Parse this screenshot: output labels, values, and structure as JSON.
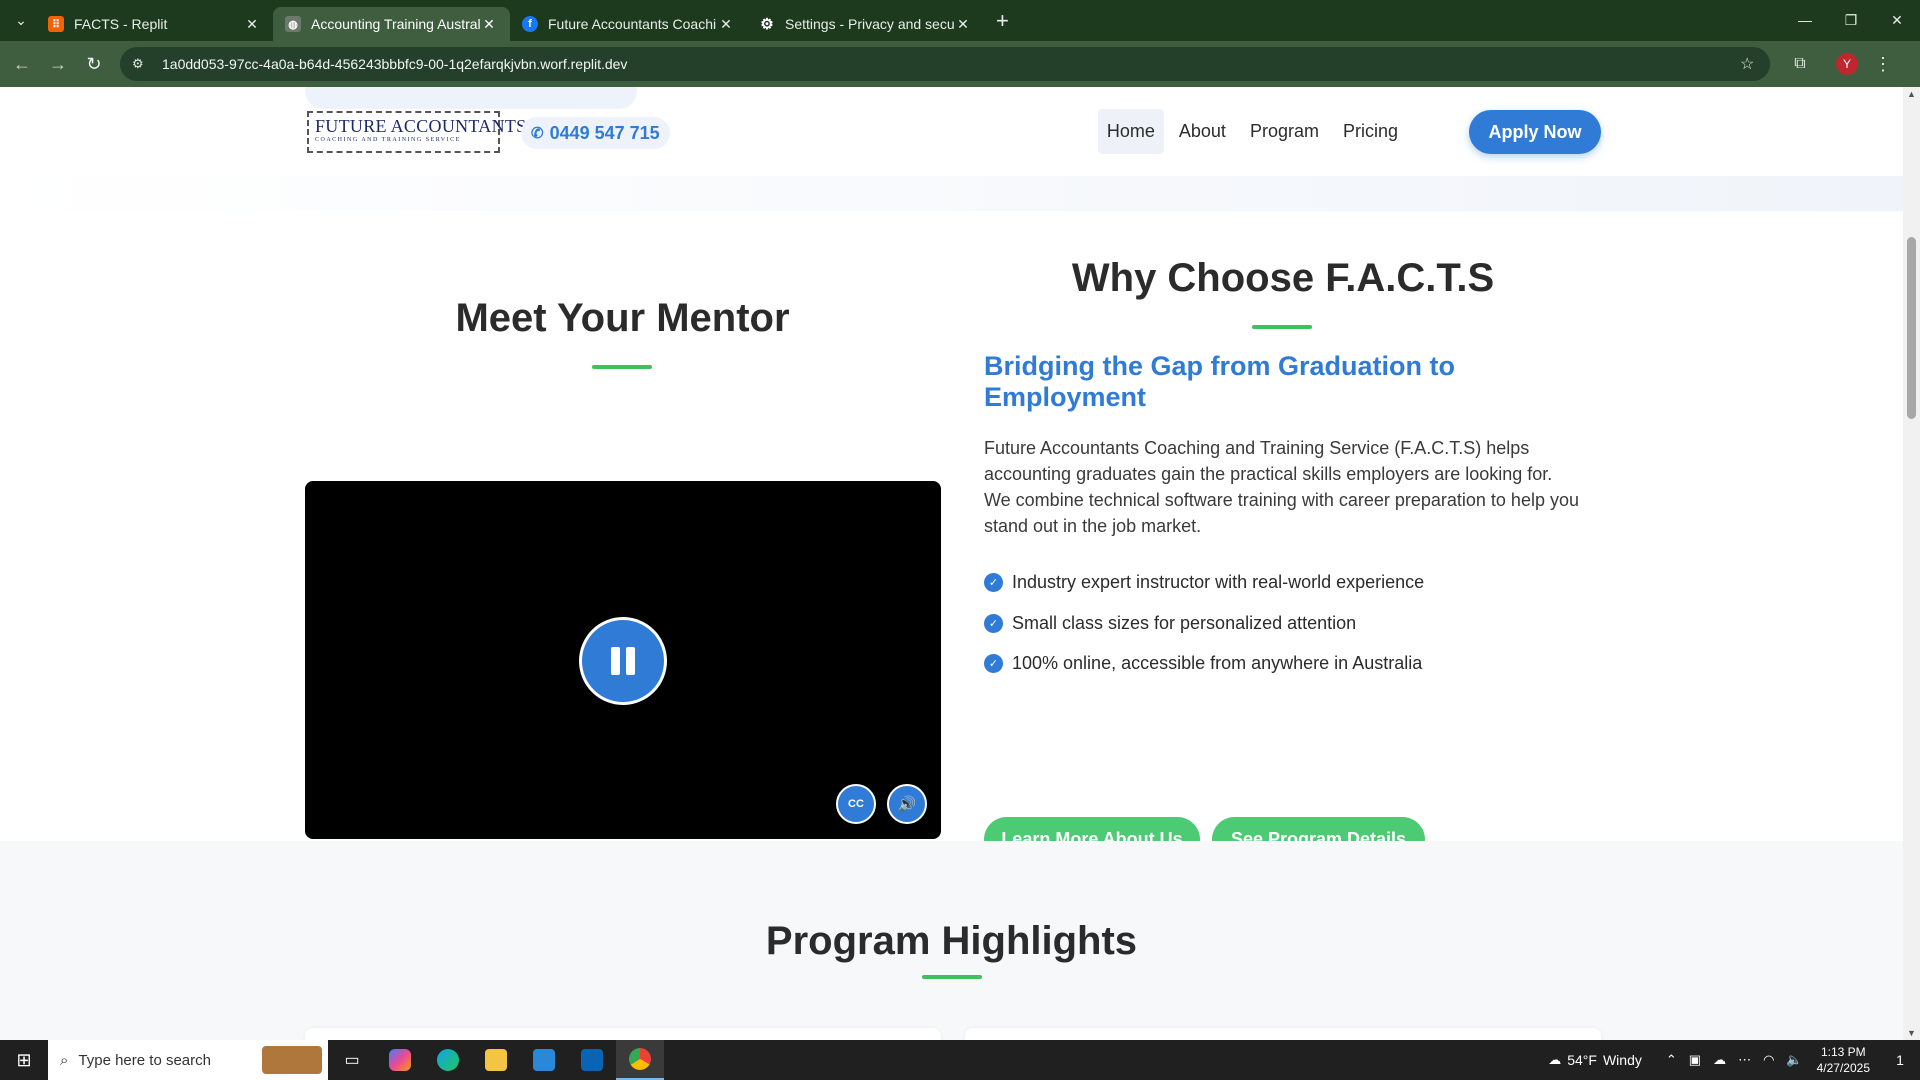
{
  "browser": {
    "tabs": [
      {
        "title": "FACTS - Replit",
        "active": false,
        "favicon": "replit-icon"
      },
      {
        "title": "Accounting Training Australia | ",
        "active": true,
        "favicon": "globe-icon"
      },
      {
        "title": "Future Accountants Coaching & ",
        "active": false,
        "favicon": "facebook-icon"
      },
      {
        "title": "Settings - Privacy and security",
        "active": false,
        "favicon": "gear-icon"
      }
    ],
    "url": "1a0dd053-97cc-4a0a-b64d-456243bbbfc9-00-1q2efarqkjvbn.worf.replit.dev",
    "profile_initial": "Y"
  },
  "header": {
    "logo_line1": "FUTURE ACCOUNTANTS",
    "logo_line2": "COACHING AND TRAINING SERVICE",
    "phone": "0449 547 715",
    "nav": [
      "Home",
      "About",
      "Program",
      "Pricing"
    ],
    "nav_active": "Home",
    "apply_label": "Apply Now"
  },
  "mentor": {
    "title": "Meet Your Mentor",
    "cc_label": "CC"
  },
  "why": {
    "title": "Why Choose F.A.C.T.S",
    "subheading": "Bridging the Gap from Graduation to Employment",
    "paragraph": "Future Accountants Coaching and Training Service (F.A.C.T.S) helps accounting graduates gain the practical skills employers are looking for. We combine technical software training with career preparation to help you stand out in the job market.",
    "features": [
      "Industry expert instructor with real-world experience",
      "Small class sizes for personalized attention",
      "100% online, accessible from anywhere in Australia"
    ],
    "btn_learn": "Learn More About Us",
    "btn_program": "See Program Details"
  },
  "highlights": {
    "title": "Program Highlights"
  },
  "taskbar": {
    "search_placeholder": "Type here to search",
    "weather_temp": "54°F",
    "weather_desc": "Windy",
    "time": "1:13 PM",
    "date": "4/27/2025",
    "notif_count": "1"
  },
  "colors": {
    "brand_blue": "#2f7bd6",
    "accent_green": "#3cc161",
    "button_green": "#4ccb74"
  }
}
